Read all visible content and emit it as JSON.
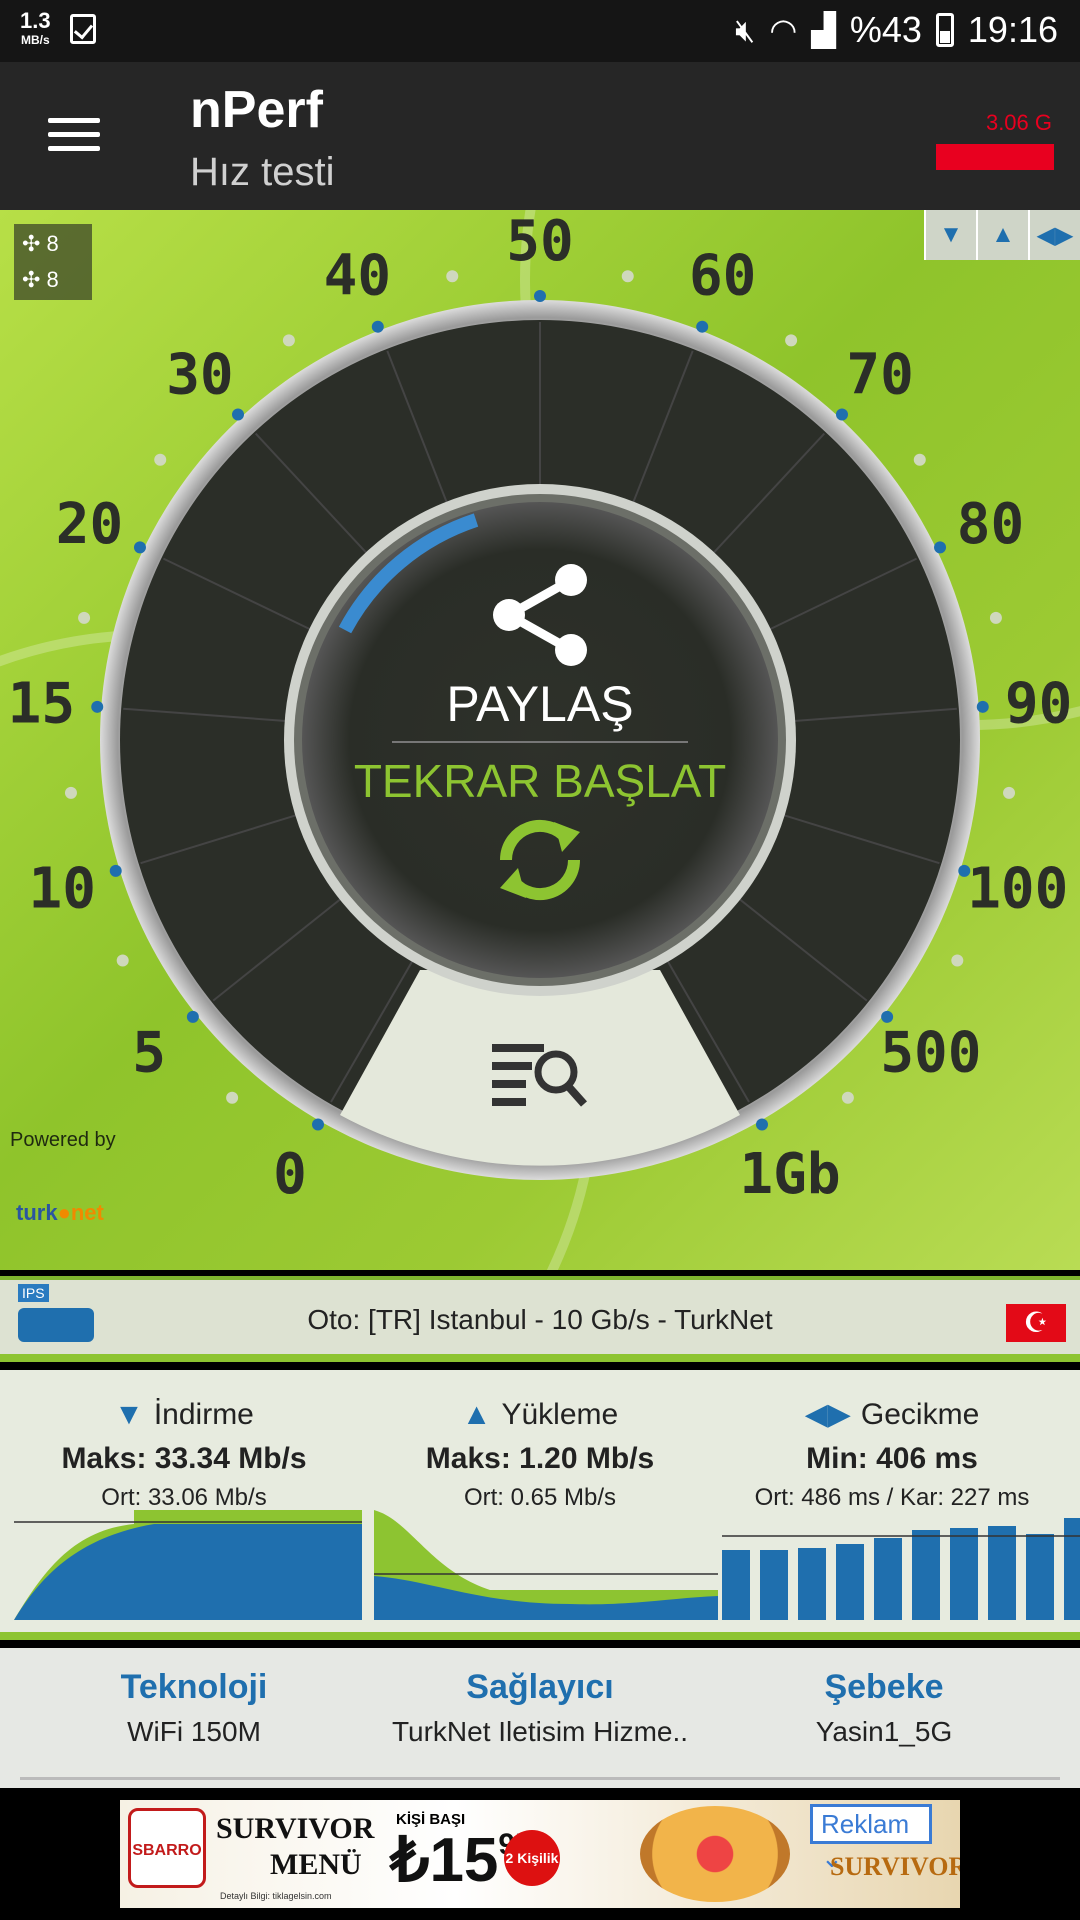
{
  "status_bar": {
    "speed": "1.3",
    "speed_unit": "MB/s",
    "battery": "%43",
    "time": "19:16"
  },
  "app_bar": {
    "title": "nPerf",
    "subtitle": "Hız testi",
    "quota": "3.06 G"
  },
  "servers_badge": {
    "count_a": "8",
    "count_b": "8"
  },
  "gauge": {
    "ticks": [
      "0",
      "5",
      "10",
      "15",
      "20",
      "30",
      "40",
      "50",
      "60",
      "70",
      "80",
      "90",
      "100",
      "500",
      "1Gb"
    ],
    "share_label": "PAYLAŞ",
    "restart_label": "TEKRAR BAŞLAT"
  },
  "powered_by": {
    "label": "Powered by",
    "brand_a": "turk",
    "brand_b": "net"
  },
  "server": {
    "tag": "IPS",
    "text": "Oto: [TR] Istanbul - 10 Gb/s - TurkNet",
    "flag": "☪"
  },
  "results": {
    "download": {
      "title": "İndirme",
      "max": "Maks: 33.34 Mb/s",
      "avg": "Ort: 33.06 Mb/s"
    },
    "upload": {
      "title": "Yükleme",
      "max": "Maks: 1.20 Mb/s",
      "avg": "Ort: 0.65 Mb/s"
    },
    "latency": {
      "title": "Gecikme",
      "min": "Min: 406 ms",
      "avg": "Ort: 486 ms / Kar: 227 ms"
    }
  },
  "info": {
    "tech_title": "Teknoloji",
    "tech_value": "WiFi 150M",
    "provider_title": "Sağlayıcı",
    "provider_value": "TurkNet Iletisim Hizme..",
    "network_title": "Şebeke",
    "network_value": "Yasin1_5G"
  },
  "ad": {
    "brand": "SBARRO",
    "line1": "SURVIVOR",
    "line2": "MENÜ",
    "per_person": "KİŞİ BAŞI",
    "price": "₺15",
    "price_cents": "95",
    "badge": "2 Kişilik",
    "fine_print": "Detaylı Bilgi: tiklagelsin.com",
    "label": "Reklam",
    "brand2": "SURVIVOR"
  },
  "colors": {
    "accent_green": "#8dc431",
    "accent_blue": "#1f6fae",
    "quota_red": "#e8001f"
  }
}
